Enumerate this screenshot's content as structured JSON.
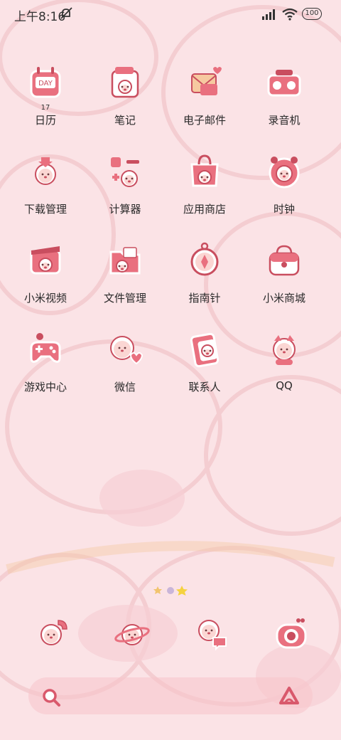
{
  "status_bar": {
    "time": "上午8:16",
    "battery": "100"
  },
  "apps": [
    {
      "label": "日历",
      "icon": "calendar-icon",
      "badge": "17"
    },
    {
      "label": "笔记",
      "icon": "notes-icon"
    },
    {
      "label": "电子邮件",
      "icon": "email-icon"
    },
    {
      "label": "录音机",
      "icon": "recorder-icon"
    },
    {
      "label": "下载管理",
      "icon": "download-icon"
    },
    {
      "label": "计算器",
      "icon": "calculator-icon"
    },
    {
      "label": "应用商店",
      "icon": "app-store-icon"
    },
    {
      "label": "时钟",
      "icon": "clock-icon"
    },
    {
      "label": "小米视频",
      "icon": "video-icon"
    },
    {
      "label": "文件管理",
      "icon": "folder-icon"
    },
    {
      "label": "指南针",
      "icon": "compass-icon"
    },
    {
      "label": "小米商城",
      "icon": "shopping-bag-icon"
    },
    {
      "label": "游戏中心",
      "icon": "gamepad-icon"
    },
    {
      "label": "微信",
      "icon": "wechat-icon"
    },
    {
      "label": "联系人",
      "icon": "contacts-icon"
    },
    {
      "label": "QQ",
      "icon": "qq-icon"
    }
  ],
  "dock": [
    {
      "icon": "phone-icon"
    },
    {
      "icon": "browser-icon"
    },
    {
      "icon": "messages-icon"
    },
    {
      "icon": "camera-icon"
    }
  ],
  "colors": {
    "background": "#fbe3e6",
    "icon_pink": "#e9707f",
    "icon_dark": "#c94e5f",
    "face": "#fbd6d3"
  }
}
